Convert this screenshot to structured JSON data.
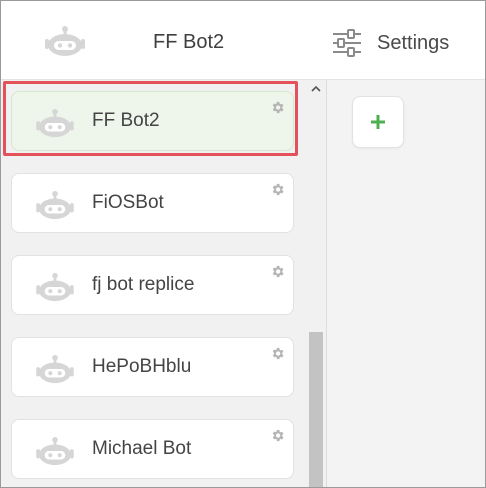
{
  "header": {
    "logo_icon": "robot-icon",
    "title": "FF Bot2",
    "settings_label": "Settings",
    "settings_icon": "sliders-icon"
  },
  "bots": [
    {
      "name": "FF Bot2",
      "selected": true
    },
    {
      "name": "FiOSBot",
      "selected": false
    },
    {
      "name": "fj bot replice",
      "selected": false
    },
    {
      "name": "HePoBHblu",
      "selected": false
    },
    {
      "name": "Michael Bot",
      "selected": false
    }
  ],
  "colors": {
    "selected_card": "#eef5ea",
    "highlight_border": "#e3525a",
    "add_icon": "#4caf50",
    "robot_icon": "#d6d6d6"
  },
  "add_button_icon": "plus-icon"
}
